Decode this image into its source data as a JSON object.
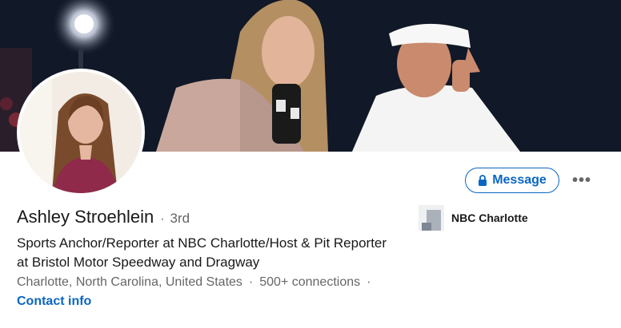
{
  "profile": {
    "name": "Ashley Stroehlein",
    "degree": "3rd",
    "separator": "·",
    "headline": "Sports Anchor/Reporter at NBC Charlotte/Host & Pit Reporter at Bristol Motor Speedway and Dragway",
    "location": "Charlotte, North Carolina, United States",
    "connections": "500+ connections",
    "contact_label": "Contact info"
  },
  "actions": {
    "message_label": "Message",
    "more_label": "•••"
  },
  "company": {
    "name": "NBC Charlotte"
  },
  "colors": {
    "accent": "#0a66c2",
    "muted_text": "#666666"
  },
  "icons": {
    "lock": "lock-icon",
    "more": "more-horizontal-icon"
  }
}
